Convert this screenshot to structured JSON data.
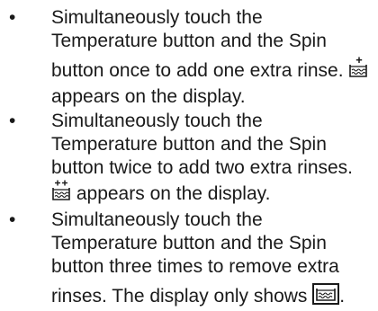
{
  "bullet_symbol": "•",
  "items": [
    {
      "lines": [
        "Simultaneously touch the",
        "Temperature button and the Spin"
      ],
      "line3_before_icon": "button once to add one extra rinse.",
      "line4": "appears on the display.",
      "icon": "rinse-plus-one-icon"
    },
    {
      "lines": [
        "Simultaneously touch the",
        "Temperature button and the Spin",
        "button twice to add two extra rinses."
      ],
      "line_after_icon": "appears on the display.",
      "icon": "rinse-plus-two-icon"
    },
    {
      "lines": [
        "Simultaneously touch the",
        "Temperature button and the Spin",
        "button three times to remove extra"
      ],
      "line_before_icon": "rinses. The display only shows",
      "line_end": ".",
      "icon": "rinse-icon"
    }
  ]
}
